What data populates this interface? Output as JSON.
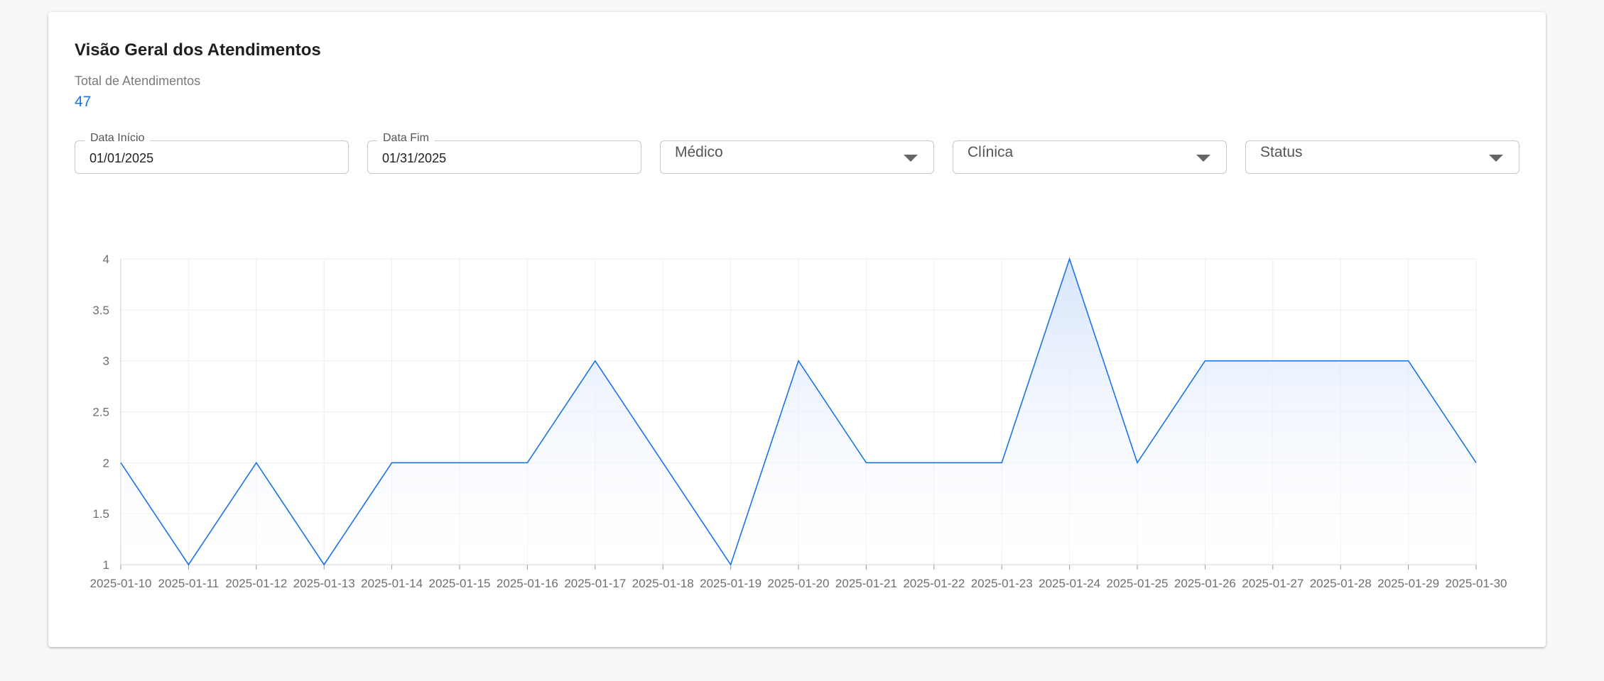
{
  "card": {
    "title": "Visão Geral dos Atendimentos",
    "total_label": "Total de Atendimentos",
    "total_value": "47"
  },
  "filters": {
    "start_date": {
      "label": "Data Início",
      "value": "01/01/2025"
    },
    "end_date": {
      "label": "Data Fim",
      "value": "01/31/2025"
    },
    "doctor": {
      "label": "Médico",
      "icon": "chevron-down-icon"
    },
    "clinic": {
      "label": "Clínica",
      "icon": "chevron-down-icon"
    },
    "status": {
      "label": "Status",
      "icon": "chevron-down-icon"
    }
  },
  "colors": {
    "accent": "#1a73e8",
    "line": "#1a73e8",
    "area_top": "#d6e4fb",
    "grid": "#eeeeee"
  },
  "chart_data": {
    "type": "area",
    "x": [
      "2025-01-10",
      "2025-01-11",
      "2025-01-12",
      "2025-01-13",
      "2025-01-14",
      "2025-01-15",
      "2025-01-16",
      "2025-01-17",
      "2025-01-18",
      "2025-01-19",
      "2025-01-20",
      "2025-01-21",
      "2025-01-22",
      "2025-01-23",
      "2025-01-24",
      "2025-01-25",
      "2025-01-26",
      "2025-01-27",
      "2025-01-28",
      "2025-01-29",
      "2025-01-30"
    ],
    "values": [
      2,
      1,
      2,
      1,
      2,
      2,
      2,
      3,
      2,
      1,
      3,
      2,
      2,
      2,
      4,
      2,
      3,
      3,
      3,
      3,
      2
    ],
    "ylim": [
      1,
      4
    ],
    "yticks": [
      "1",
      "1.5",
      "2",
      "2.5",
      "3",
      "3.5",
      "4"
    ],
    "title": "",
    "xlabel": "",
    "ylabel": "",
    "grid": true,
    "legend": "none"
  }
}
